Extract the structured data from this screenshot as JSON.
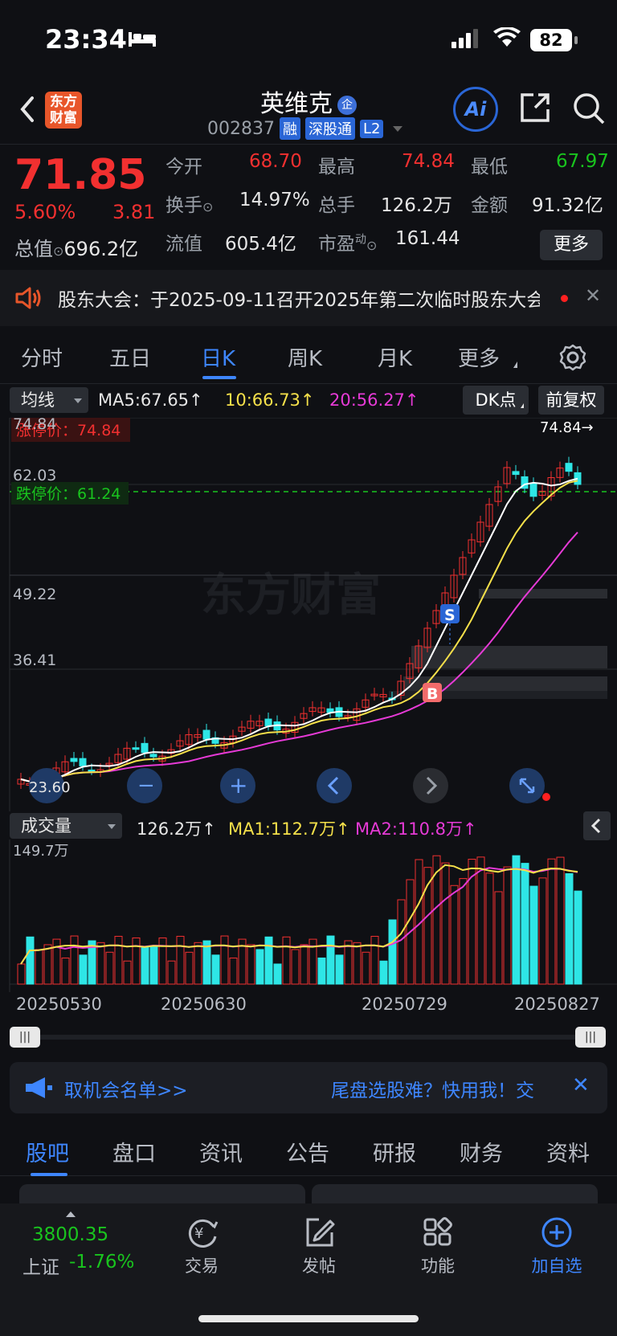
{
  "status": {
    "time": "23:34",
    "battery": "82"
  },
  "header": {
    "name": "英维克",
    "badge": "企",
    "code": "002837",
    "tags": [
      "融",
      "深股通",
      "L2"
    ],
    "ai": "Ai",
    "logo_line1": "东方",
    "logo_line2": "财富"
  },
  "quote": {
    "price": "71.85",
    "pct": "5.60%",
    "change": "3.81",
    "total_value_label": "总值",
    "total_value": "696.2亿",
    "open_label": "今开",
    "open": "68.70",
    "high_label": "最高",
    "high": "74.84",
    "low_label": "最低",
    "low": "67.97",
    "turnover_label": "换手",
    "turnover": "14.97%",
    "volume_label": "总手",
    "volume": "126.2万",
    "amount_label": "金额",
    "amount": "91.32亿",
    "float_label": "流值",
    "float": "605.4亿",
    "pe_label": "市盈",
    "pe_sup": "动",
    "pe": "161.44",
    "more": "更多"
  },
  "notice": {
    "text": "股东大会：于2025-09-11召开2025年第二次临时股东大会"
  },
  "ktabs": [
    "分时",
    "五日",
    "日K",
    "周K",
    "月K",
    "更多"
  ],
  "indicator": {
    "select": "均线",
    "ma5": "MA5:67.65↑",
    "ma10": "10:66.73↑",
    "ma20": "20:56.27↑",
    "dk": "DK点",
    "adjust": "前复权"
  },
  "kchart": {
    "y_labels": [
      "74.84",
      "62.03",
      "49.22",
      "36.41"
    ],
    "limit_up": "涨停价：74.84",
    "limit_down": "跌停价：61.24",
    "high_marker": "74.84→",
    "low_marker": "23.60",
    "watermark": "东方财富",
    "sell_mark": "S",
    "buy_mark": "B"
  },
  "volume": {
    "select": "成交量",
    "vol": "126.2万↑",
    "ma1": "MA1:112.7万↑",
    "ma2": "MA2:110.8万↑",
    "max_label": "149.7万"
  },
  "dates": [
    "20250530",
    "20250630",
    "20250729",
    "20250827"
  ],
  "promo": {
    "left": "取机会名单>>",
    "right": "尾盘选股难？快用我！交"
  },
  "btabs": [
    "股吧",
    "盘口",
    "资讯",
    "公告",
    "研报",
    "财务",
    "资料"
  ],
  "bottom": {
    "index_value": "3800.35",
    "index_name": "上证",
    "index_pct": "-1.76%",
    "trade": "交易",
    "post": "发帖",
    "func": "功能",
    "add": "加自选"
  },
  "colors": {
    "up": "#f23030",
    "down": "#19c41e",
    "cyan": "#2ee6e6",
    "accent": "#3e86ff"
  }
}
